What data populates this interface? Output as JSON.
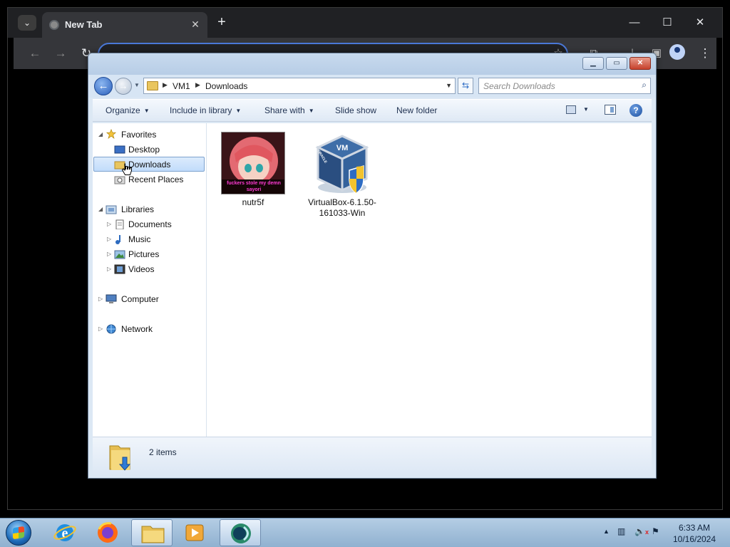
{
  "chrome": {
    "tab_title": "New Tab",
    "tab_close": "✕",
    "new_tab": "+",
    "minimize": "—",
    "maximize": "☐",
    "close": "✕",
    "back": "←",
    "forward": "→",
    "reload": "↻",
    "menu": "⋮",
    "icons": [
      "tab-search-icon",
      "globe-icon",
      "bookmark-star-icon",
      "extensions-icon",
      "profile-icon",
      "menu-icon"
    ]
  },
  "explorer": {
    "breadcrumb": [
      "VM1",
      "Downloads"
    ],
    "search_placeholder": "Search Downloads",
    "commands": {
      "organize": "Organize",
      "include_in_library": "Include in library",
      "share_with": "Share with",
      "slide_show": "Slide show",
      "new_folder": "New folder"
    },
    "nav": {
      "favorites": "Favorites",
      "desktop": "Desktop",
      "downloads": "Downloads",
      "recent_places": "Recent Places",
      "libraries": "Libraries",
      "documents": "Documents",
      "music": "Music",
      "pictures": "Pictures",
      "videos": "Videos",
      "computer": "Computer",
      "network": "Network"
    },
    "selected_nav": "Downloads",
    "files": [
      {
        "name": "nutr5f",
        "thumb_caption": "fuckers stole my demn sayori"
      },
      {
        "name": "VirtualBox-6.1.50-161033-Win",
        "cube_label": "ORACLE"
      }
    ],
    "item_count": "2 items"
  },
  "taskbar": {
    "apps": [
      "internet-explorer-icon",
      "firefox-icon",
      "file-explorer-icon",
      "media-player-icon",
      "virtualbox-icon"
    ],
    "time": "6:33 AM",
    "date": "10/16/2024"
  }
}
